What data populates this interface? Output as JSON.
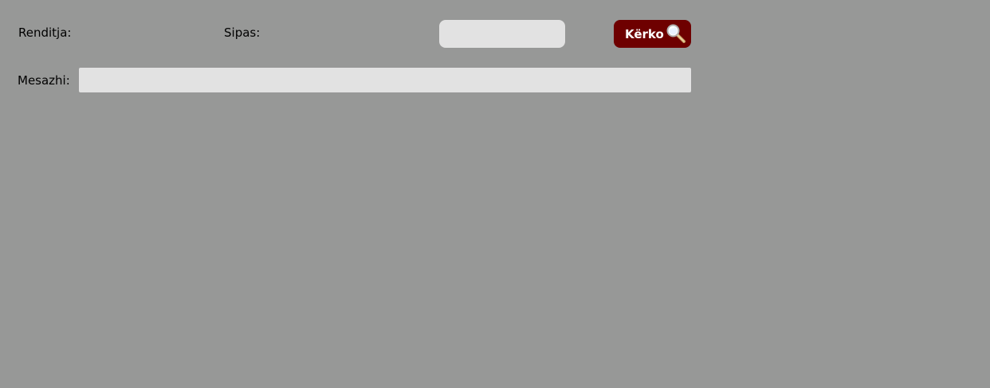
{
  "colors": {
    "background": "#979897",
    "field_background": "#e2e2e2",
    "button_background": "#6e0000",
    "button_text": "#ffffff",
    "label_text": "#000000"
  },
  "form": {
    "order_label": "Renditja:",
    "by_label": "Sipas:",
    "message_label": "Mesazhi:",
    "sort_value": "",
    "message_value": ""
  },
  "search_button": {
    "label": "Kërko",
    "icon": "magnifier-icon"
  }
}
